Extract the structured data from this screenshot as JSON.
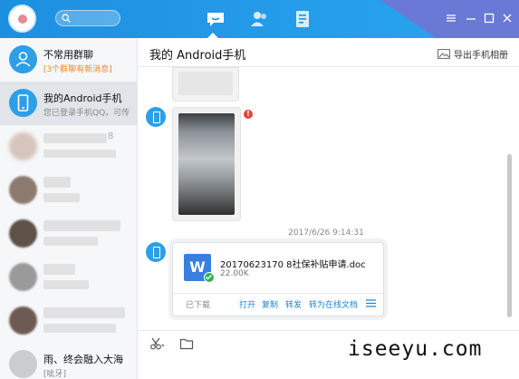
{
  "sidebar": {
    "items": [
      {
        "name": "不常用群聊",
        "sub": "[3个群聊有新消息]",
        "sub_alert": true
      },
      {
        "name": "我的Android手机",
        "sub": "您已登录手机QQ，可传",
        "active": true
      },
      {
        "name": "",
        "sub": ""
      },
      {
        "name": "",
        "sub": ""
      },
      {
        "name": "",
        "sub": ""
      },
      {
        "name": "",
        "sub": ""
      },
      {
        "name": "",
        "sub": ""
      },
      {
        "name": "雨、终会融入大海",
        "sub": "[呲牙]"
      }
    ],
    "blur_fragment": "8"
  },
  "chat": {
    "title": "我的 Android手机",
    "export_label": "导出手机相册",
    "timestamp": "2017/6/26 9:14:31",
    "error_mark": "!",
    "file": {
      "icon_letter": "W",
      "name": "20170623170 8社保补贴申请.doc",
      "size": "22.00K",
      "status": "已下载",
      "actions": [
        "打开",
        "复制",
        "转发",
        "转为在线文档"
      ]
    }
  },
  "watermark": "iseeyu.com",
  "colors": {
    "accent": "#1e8fe0",
    "alert": "#f08a1c",
    "link": "#1a84d8"
  }
}
